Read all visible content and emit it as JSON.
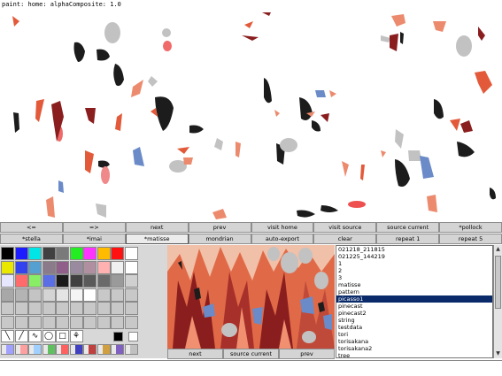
{
  "title": "paint: home: alphaComposite: 1.0",
  "nav_row": [
    "<=",
    "=>",
    "next",
    "prev",
    "visit home",
    "visit source",
    "source current",
    "*pollock"
  ],
  "style_row": [
    "*stella",
    "*imai",
    "*matisse",
    "mondrian",
    "auto-export",
    "clear",
    "repeat 1",
    "repeat 5"
  ],
  "style_row_active_index": 2,
  "palette": {
    "colors": [
      [
        "#000000",
        "#1c1cff",
        "#00e6e6",
        "#404040",
        "#7a7a7a",
        "#22ee22",
        "#ff33ff",
        "#ffbb00",
        "#ff1111",
        "#ffffff"
      ],
      [
        "#e8e800",
        "#3344ee",
        "#55a0d0",
        "#8a7a8a",
        "#8f5f8a",
        "#9a8aa0",
        "#b090a0",
        "#ffb0b0",
        "#f0f0f0",
        "#ffffff"
      ],
      [
        "#e6e6ff",
        "#ff6b6b",
        "#88ee66",
        "#5a6ee6",
        "#1a1a1a",
        "#404040",
        "#5a5a5a",
        "#6a6a6a",
        "#9a9a9a",
        "#d0d0d0"
      ],
      [
        "#a8a8a8",
        "#b4b4b4",
        "#c4c4c4",
        "#d4d4d4",
        "#e4e4e4",
        "#f4f4f4",
        "#ffffff",
        "#c8c8c8",
        "#c8c8c8",
        "#c8c8c8"
      ],
      [
        "#c8c8c8",
        "#c8c8c8",
        "#c8c8c8",
        "#c8c8c8",
        "#c8c8c8",
        "#c8c8c8",
        "#c8c8c8",
        "#c8c8c8",
        "#c8c8c8",
        "#c8c8c8"
      ],
      [
        "#c8c8c8",
        "#c8c8c8",
        "#c8c8c8",
        "#c8c8c8",
        "#c8c8c8",
        "#c8c8c8",
        "#c8c8c8",
        "#c8c8c8",
        "#c8c8c8",
        "#c8c8c8"
      ]
    ],
    "tools": [
      "line-tool",
      "pen-tool",
      "curve-tool",
      "ellipse-tool",
      "rect-tool",
      "stamp-tool"
    ],
    "current_fg": "#000000",
    "current_bg": "#ffffff",
    "swatch_strip": [
      "#a0a0ff",
      "#ffa0a0",
      "#a0d0ff",
      "#60c060",
      "#ff6060",
      "#4040c0",
      "#c04040",
      "#d0a040",
      "#8060c0",
      "#c0c0c0"
    ]
  },
  "preview_buttons": [
    "next",
    "source current",
    "prev"
  ],
  "list": {
    "items": [
      "021218_211815",
      "021225_144219",
      "1",
      "2",
      "3",
      "matisse",
      "pattern",
      "picasso1",
      "pinecast",
      "pinecast2",
      "string",
      "testdata",
      "tori",
      "torisakana",
      "torisakana2",
      "tree"
    ],
    "selected_index": 7
  },
  "colors": {
    "shape_red": "#e25a3a",
    "shape_dark": "#1c1c1c",
    "shape_grey": "#c2c2c2",
    "shape_blue": "#6a8ac8",
    "shape_maroon": "#8a1e1e",
    "shape_salmon": "#ec8a6e",
    "selection": "#0a2a6a"
  }
}
